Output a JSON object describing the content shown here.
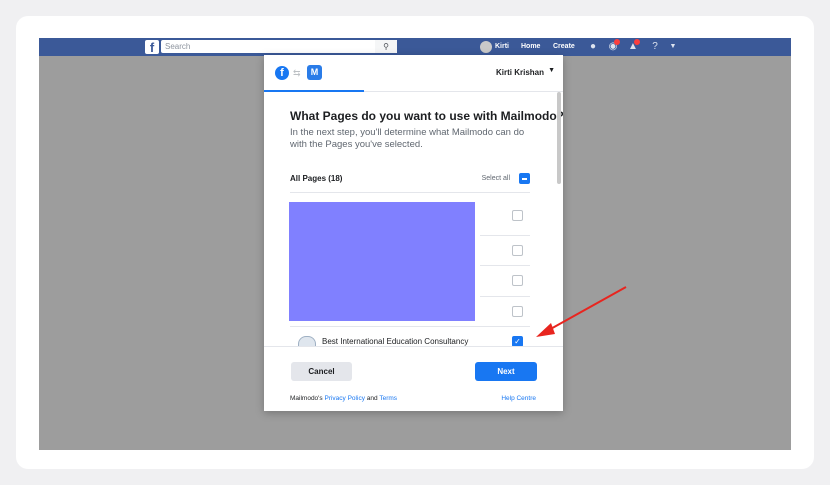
{
  "facebook_bar": {
    "search_placeholder": "Search",
    "user": "Kirti",
    "nav_home": "Home",
    "nav_create": "Create",
    "search_icon": "search-icon",
    "color": "#3b5998"
  },
  "dialog": {
    "user_name": "Kirti Krishan",
    "title": "What Pages do you want to use with Mailmodo?",
    "subtitle": "In the next step, you'll determine what Mailmodo can do with the Pages you've selected.",
    "all_pages_label": "All Pages (18)",
    "select_all_label": "Select all",
    "pages": [
      {
        "name": "",
        "checked": false
      },
      {
        "name": "",
        "checked": false
      },
      {
        "name": "",
        "checked": false
      },
      {
        "name": "",
        "checked": false
      },
      {
        "name": "Best International Education Consultancy",
        "checked": true
      }
    ],
    "cancel_label": "Cancel",
    "next_label": "Next",
    "policy_prefix": "Mailmodo's",
    "policy_link": "Privacy Policy",
    "policy_and": "and",
    "terms_link": "Terms",
    "help_link": "Help Centre",
    "accent": "#1877f2"
  },
  "annotation": {
    "arrow_color": "#e8251f"
  }
}
